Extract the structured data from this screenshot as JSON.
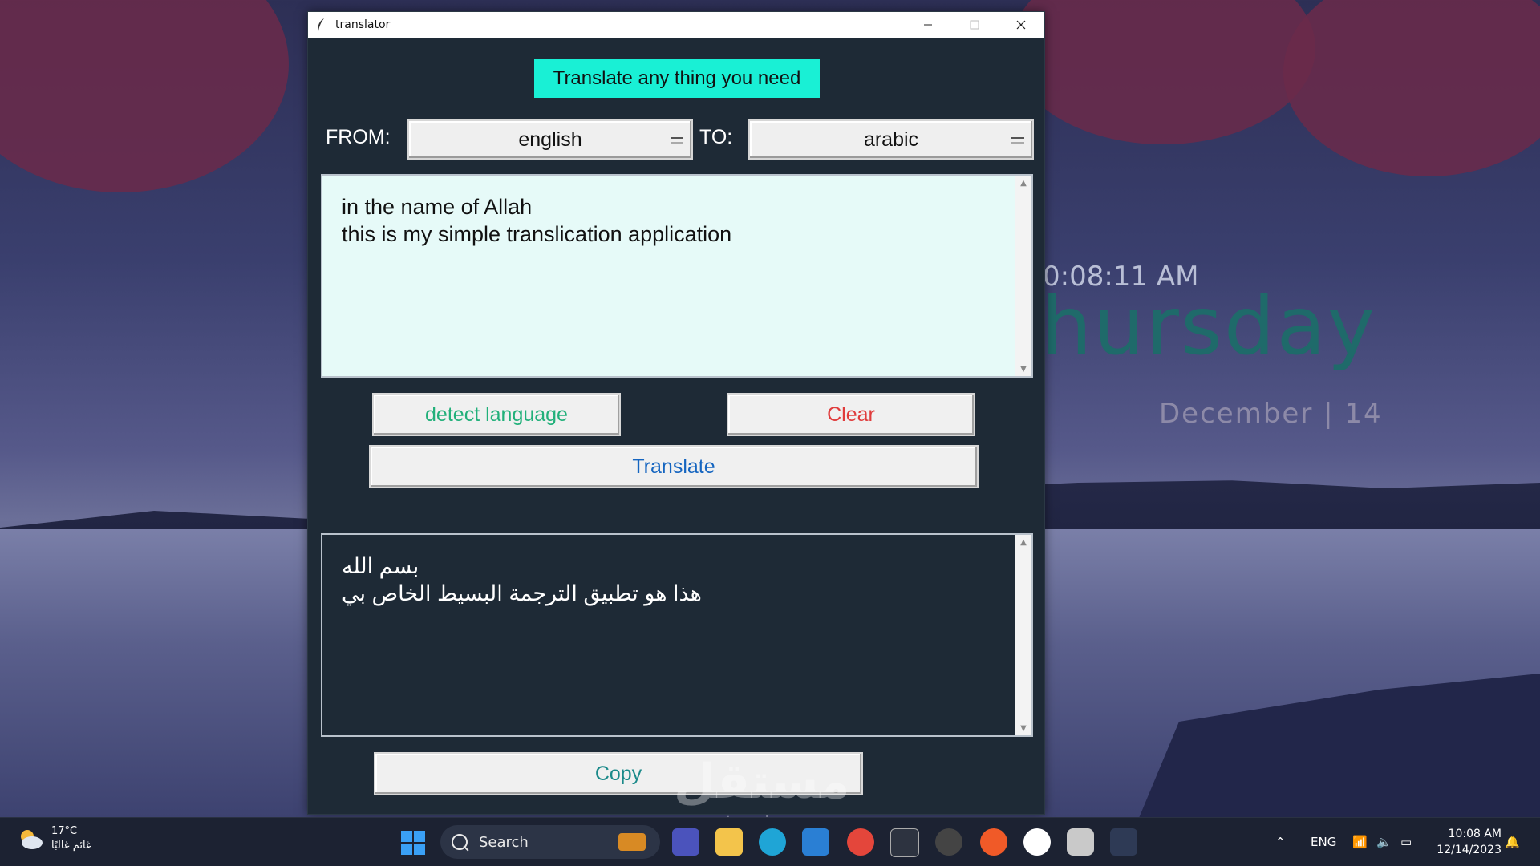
{
  "desktop": {
    "clock_time": "0:08:11 AM",
    "clock_day": "hursday",
    "clock_date": "December | 14"
  },
  "window": {
    "title": "translator",
    "heading": "Translate any thing you need",
    "from_label": "FROM:",
    "from_value": "english",
    "to_label": "TO:",
    "to_value": "arabic",
    "input_text": "in the name of Allah\nthis is my simple translication application",
    "detect_label": "detect language",
    "clear_label": "Clear",
    "translate_label": "Translate",
    "output_text": "بسم الله\nهذا هو تطبيق الترجمة البسيط الخاص بي",
    "copy_label": "Copy"
  },
  "taskbar": {
    "weather_temp": "17°C",
    "weather_desc": "غائم غالبًا",
    "search_label": "Search",
    "lang": "ENG",
    "time": "10:08 AM",
    "date": "12/14/2023"
  },
  "watermark": {
    "main": "مستقل",
    "sub": "mostaql.com"
  },
  "colors": {
    "heading_bg": "#19f0d5",
    "window_bg": "#1e2a36",
    "input_bg": "#e6faf8",
    "detect_color": "#21b07a",
    "clear_color": "#e03c3c",
    "translate_color": "#1565c0",
    "copy_color": "#1b8a8a"
  }
}
